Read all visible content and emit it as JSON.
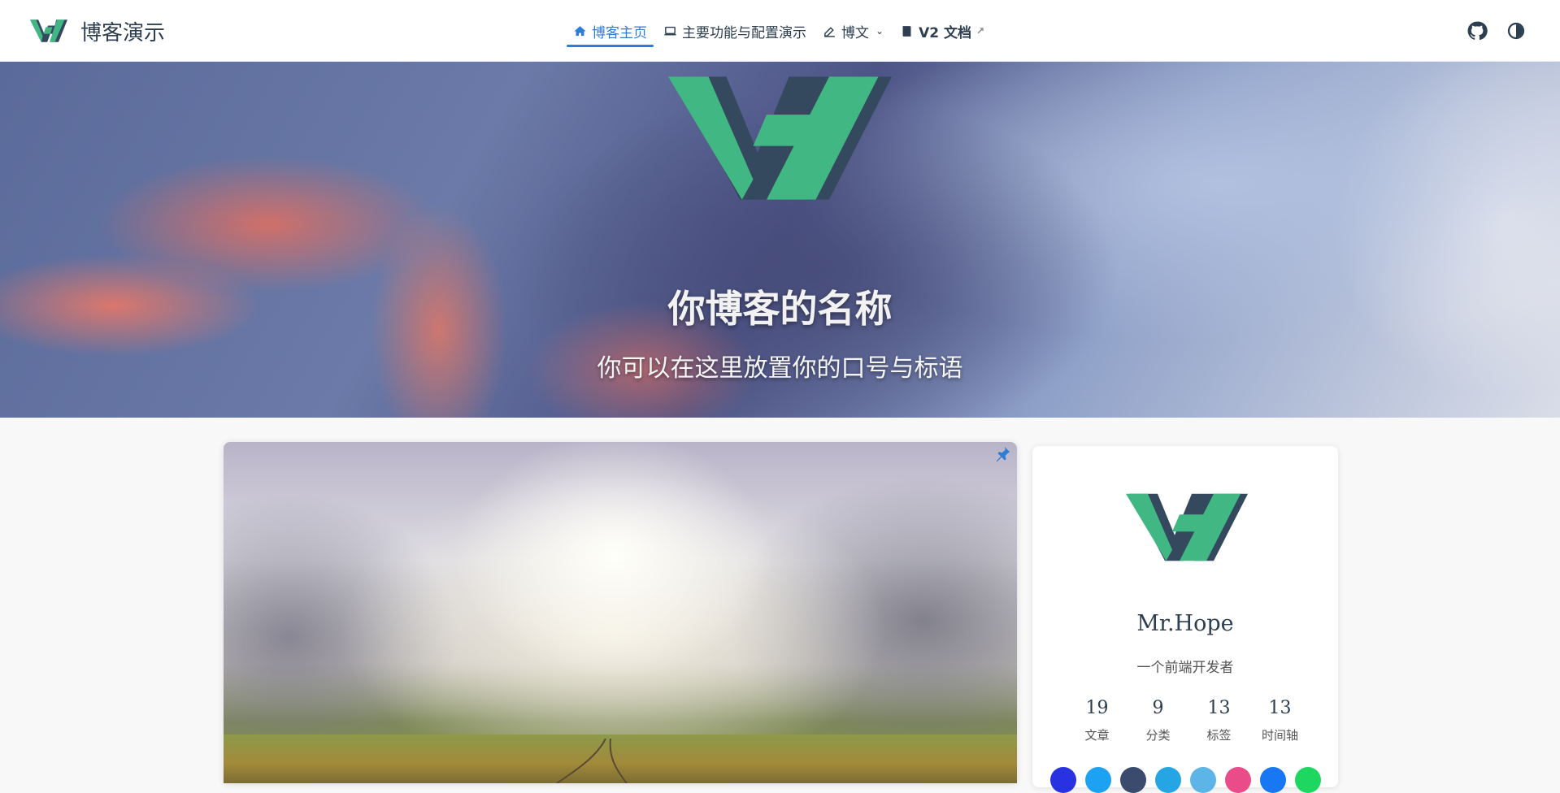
{
  "navbar": {
    "brand_title": "博客演示",
    "links": [
      {
        "label": "博客主页",
        "icon": "home-icon",
        "active": true
      },
      {
        "label": "主要功能与配置演示",
        "icon": "laptop-icon"
      },
      {
        "label": "博文",
        "icon": "edit-icon",
        "dropdown": true
      },
      {
        "label": "V2 文档",
        "icon": "book-icon",
        "external": true
      }
    ],
    "right_icons": [
      "github-icon",
      "theme-toggle-icon"
    ]
  },
  "hero": {
    "title": "你博客的名称",
    "subtitle": "你可以在这里放置你的口号与标语"
  },
  "profile": {
    "name": "Mr.Hope",
    "description": "一个前端开发者",
    "stats": [
      {
        "value": "19",
        "label": "文章"
      },
      {
        "value": "9",
        "label": "分类"
      },
      {
        "value": "13",
        "label": "标签"
      },
      {
        "value": "13",
        "label": "时间轴"
      }
    ],
    "social_colors": [
      "#2932e1",
      "#1da1f2",
      "#3a4b6e",
      "#26a5e4",
      "#5db4e6",
      "#ea4c89",
      "#1877f2",
      "#1ed760"
    ]
  },
  "colors": {
    "accent": "#2c7dd6",
    "logo_green": "#41b883",
    "logo_dark": "#35495e"
  }
}
